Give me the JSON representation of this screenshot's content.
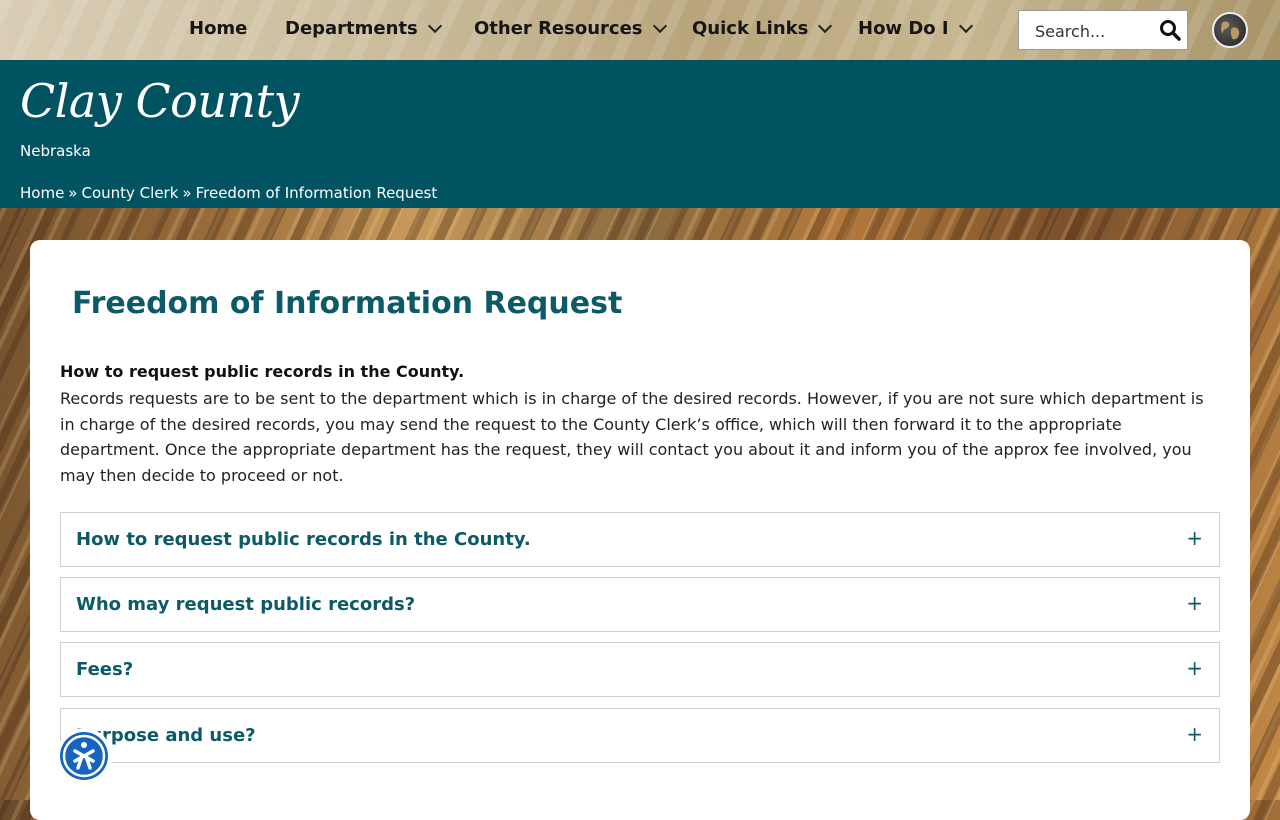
{
  "nav": {
    "home": "Home",
    "departments": "Departments",
    "other_resources": "Other Resources",
    "quick_links": "Quick Links",
    "how_do_i": "How Do I"
  },
  "search": {
    "placeholder": "Search..."
  },
  "site": {
    "title": "Clay County",
    "subtitle": "Nebraska"
  },
  "breadcrumb": {
    "items": [
      "Home",
      "County Clerk",
      "Freedom of Information Request"
    ],
    "separator": "»"
  },
  "page": {
    "title": "Freedom of Information Request",
    "intro_heading": "How to request public records in the County.",
    "intro_text": "Records requests are to be sent to the department which is in charge of the desired records. However, if you are not sure which department is in charge of the desired records, you may send the request to the County Clerk’s office, which will then forward it to the appropriate department. Once the appropriate department has the request, they will contact you about it and inform you of the approx fee involved, you may then decide to proceed or not."
  },
  "accordion": [
    {
      "label": "How to request public records in the County.",
      "icon": "+"
    },
    {
      "label": "Who may request public records?",
      "icon": "+"
    },
    {
      "label": "Fees?",
      "icon": "+"
    },
    {
      "label": "Purpose and use?",
      "icon": "+"
    }
  ],
  "colors": {
    "brand": "#015361",
    "heading": "#0c5a67",
    "accessibility": "#1565c0"
  }
}
